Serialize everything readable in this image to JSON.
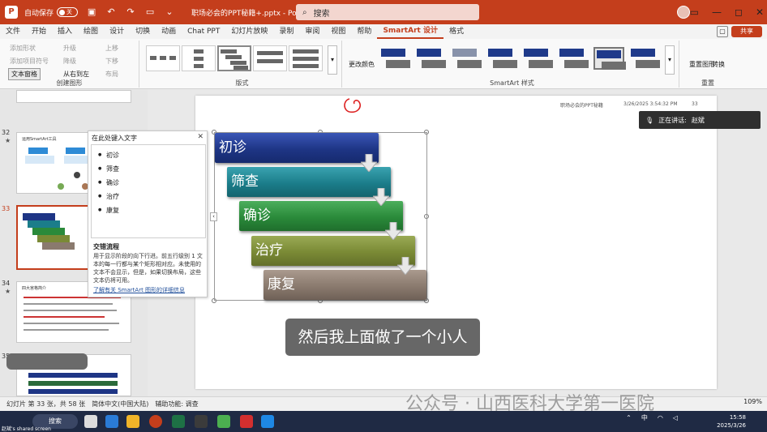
{
  "titlebar": {
    "autosave_label": "自动保存",
    "autosave_state": "关",
    "doc_title": "职场必会的PPT秘籍+.pptx  -  PowerPoint",
    "search_placeholder": "搜索"
  },
  "menu": {
    "tabs": [
      "文件",
      "开始",
      "插入",
      "绘图",
      "设计",
      "切换",
      "动画",
      "Chat PPT",
      "幻灯片放映",
      "录制",
      "审阅",
      "视图",
      "帮助",
      "SmartArt 设计",
      "格式"
    ],
    "active_tab": "SmartArt 设计",
    "share_label": "共享"
  },
  "ribbon": {
    "create_group": {
      "add_shape": "添加形状",
      "add_bullet": "添加项目符号",
      "text_pane": "文本窗格",
      "promote": "升级",
      "demote": "降级",
      "rtl": "从右到左",
      "move_up": "上移",
      "move_down": "下移",
      "layout": "布局",
      "label": "创建图形"
    },
    "layouts_label": "版式",
    "change_colors": "更改颜色",
    "styles_label": "SmartArt 样式",
    "reset_graphic": "重置图形",
    "convert": "转换",
    "reset_label": "重置",
    "style_colors": [
      "#1f3a8a",
      "#1f3a8a",
      "#6b7fa0",
      "#1f3a8a",
      "#1f3a8a",
      "#1f3a8a",
      "#1f3a8a",
      "#1f3a8a"
    ]
  },
  "thumbs": {
    "slide32": "32",
    "slide32_title": "运用SmartArt工具",
    "slide33": "33",
    "slide34": "34",
    "slide34_title": "四大宫格简介",
    "slide35": "35"
  },
  "slide": {
    "header_left": "职场必会的PPT秘籍",
    "header_date": "3/26/2025 3:54:32 PM",
    "header_page": "33"
  },
  "textpane": {
    "title": "在此处键入文字",
    "items": [
      "初诊",
      "筛查",
      "确诊",
      "治疗",
      "康复"
    ],
    "desc_title": "交错流程",
    "desc": "用于显示阶段的向下行进。前五行级别 1 文本的每一行都与某个矩形相对应。未使用的文本不会显示，但是，如果切换布局，这些文本仍将可用。",
    "link": "了解有关 SmartArt 图形的详细信息"
  },
  "smartart": {
    "steps": [
      "初诊",
      "筛查",
      "确诊",
      "治疗",
      "康复"
    ],
    "colors": [
      "#1e3585",
      "#1b7d8a",
      "#2a8a3a",
      "#7a8a35",
      "#8a7a6e"
    ]
  },
  "speaking": {
    "label": "正在讲话:",
    "name": "赵斌"
  },
  "subtitle": "然后我上面做了一个小人",
  "statusbar": {
    "slide_info": "幻灯片 第 33 张，共 58 张",
    "language": "简体中文(中国大陆)",
    "accessibility": "辅助功能: 调查",
    "notes": "备注",
    "zoom": "109%"
  },
  "watermark": "公众号 · 山西医科大学第一医院",
  "taskbar": {
    "search": "搜索",
    "ime": "中",
    "time": "15:58",
    "date": "2025/3/26",
    "shared_label": "赵斌's shared screen"
  }
}
